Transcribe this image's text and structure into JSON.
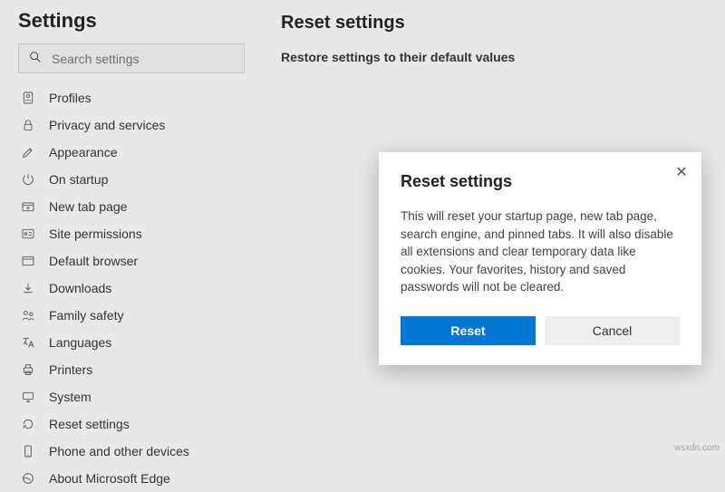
{
  "sidebar": {
    "title": "Settings",
    "search_placeholder": "Search settings",
    "items": [
      {
        "label": "Profiles"
      },
      {
        "label": "Privacy and services"
      },
      {
        "label": "Appearance"
      },
      {
        "label": "On startup"
      },
      {
        "label": "New tab page"
      },
      {
        "label": "Site permissions"
      },
      {
        "label": "Default browser"
      },
      {
        "label": "Downloads"
      },
      {
        "label": "Family safety"
      },
      {
        "label": "Languages"
      },
      {
        "label": "Printers"
      },
      {
        "label": "System"
      },
      {
        "label": "Reset settings"
      },
      {
        "label": "Phone and other devices"
      },
      {
        "label": "About Microsoft Edge"
      }
    ]
  },
  "main": {
    "title": "Reset settings",
    "subtitle": "Restore settings to their default values"
  },
  "dialog": {
    "title": "Reset settings",
    "body": "This will reset your startup page, new tab page, search engine, and pinned tabs. It will also disable all extensions and clear temporary data like cookies. Your favorites, history and saved passwords will not be cleared.",
    "primary_label": "Reset",
    "secondary_label": "Cancel"
  },
  "watermark": "wsxdn.com",
  "colors": {
    "accent": "#0078d4"
  }
}
